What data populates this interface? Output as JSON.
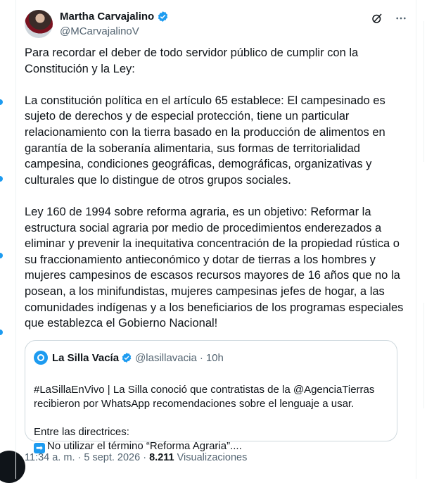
{
  "author": {
    "display_name": "Martha Carvajalino",
    "handle": "@MCarvajalinoV"
  },
  "tweet": {
    "text": "Para recordar el deber de todo servidor público de cumplir con la Constitución y la Ley:\n\nLa constitución política en el artículo 65 establece: El campesinado es sujeto de derechos y de especial protección, tiene un particular relacionamiento con la tierra basado en la producción de alimentos en garantía de la soberanía alimentaria, sus formas de territorialidad campesina, condiciones geográficas, demográficas, organizativas y culturales que lo distingue de otros grupos sociales.\n\nLey 160 de 1994 sobre reforma agraria, es un objetivo: Reformar la estructura social agraria por medio de procedimientos enderezados a eliminar y prevenir la inequitativa concentración de la propiedad rústica o su fraccionamiento antieconómico y dotar de tierras a los hombres y mujeres campesinos de escasos recursos mayores de 16 años que no la posean, a los minifundistas, mujeres campesinas jefes de hogar, a las comunidades indígenas y a los beneficiarios de los programas especiales que establezca el Gobierno Nacional!"
  },
  "quoted_tweet": {
    "display_name": "La Silla Vacía",
    "handle": "@lasillavacia",
    "separator": "·",
    "time": "10h",
    "text": "#LaSillaEnVivo | La Silla conoció que contratistas de la @AgenciaTierras recibieron por WhatsApp recomendaciones sobre el lenguaje a usar.\n\nEntre las directrices:",
    "last_line": "No utilizar el término “Reforma Agraria”....",
    "arrow_emoji": "➡"
  },
  "footer": {
    "time": "11:34 a. m.",
    "separator": "·",
    "date": "5 sept. 2026",
    "views_count": "8.211",
    "views_label": "Visualizaciones"
  },
  "icons": [
    "verified-badge-icon",
    "grok-icon",
    "more-icon"
  ],
  "colors": {
    "accent": "#1d9bf0",
    "text": "#0f1419",
    "muted": "#536471",
    "border": "#cfd9de"
  }
}
